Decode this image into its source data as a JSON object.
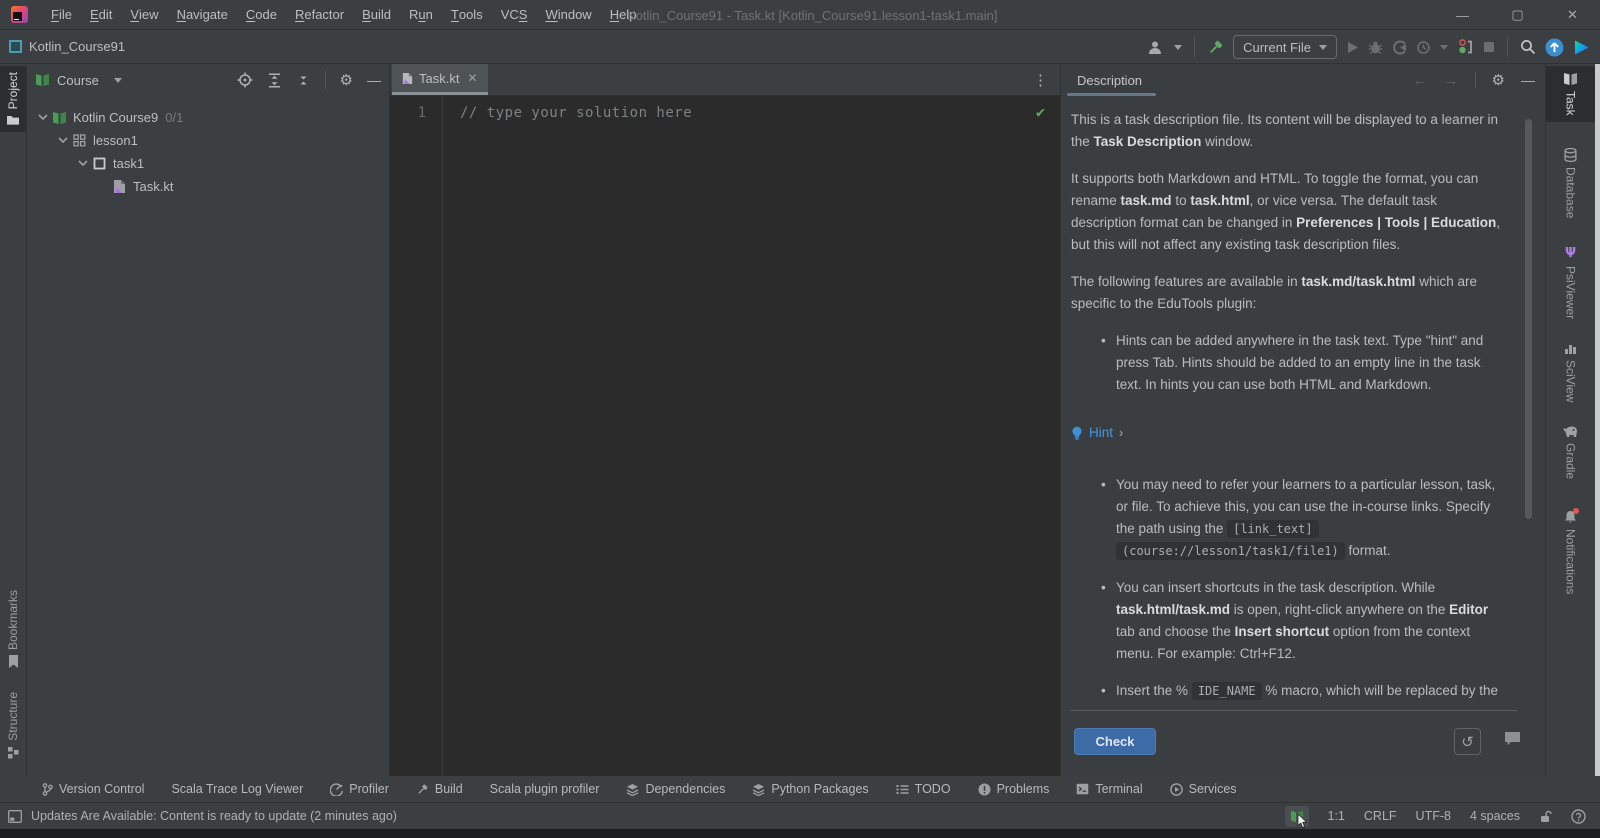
{
  "titlebar": {
    "title": "Kotlin_Course91 - Task.kt [Kotlin_Course91.lesson1-task1.main]",
    "menus": [
      {
        "pre": "",
        "key": "F",
        "post": "ile"
      },
      {
        "pre": "",
        "key": "E",
        "post": "dit"
      },
      {
        "pre": "",
        "key": "V",
        "post": "iew"
      },
      {
        "pre": "",
        "key": "N",
        "post": "avigate"
      },
      {
        "pre": "",
        "key": "C",
        "post": "ode"
      },
      {
        "pre": "",
        "key": "R",
        "post": "efactor"
      },
      {
        "pre": "",
        "key": "B",
        "post": "uild"
      },
      {
        "pre": "R",
        "key": "u",
        "post": "n"
      },
      {
        "pre": "",
        "key": "T",
        "post": "ools"
      },
      {
        "pre": "VC",
        "key": "S",
        "post": ""
      },
      {
        "pre": "",
        "key": "W",
        "post": "indow"
      },
      {
        "pre": "",
        "key": "H",
        "post": "elp"
      }
    ],
    "window_buttons": {
      "minimize": "—",
      "maximize": "▢",
      "close": "✕"
    }
  },
  "toolbar": {
    "project_name": "Kotlin_Course91",
    "run_config": "Current File"
  },
  "left_strip": {
    "items": [
      {
        "label": "Project"
      },
      {
        "label": "Bookmarks"
      },
      {
        "label": "Structure"
      }
    ]
  },
  "right_strip": {
    "items": [
      {
        "label": "Task"
      },
      {
        "label": "Database"
      },
      {
        "label": "PsiViewer"
      },
      {
        "label": "SciView"
      },
      {
        "label": "Gradle"
      },
      {
        "label": "Notifications"
      }
    ]
  },
  "project_panel": {
    "view_selector": "Course",
    "tree": [
      {
        "label": "Kotlin Course9",
        "suffix": "0/1"
      },
      {
        "label": "lesson1",
        "suffix": ""
      },
      {
        "label": "task1",
        "suffix": ""
      },
      {
        "label": "Task.kt",
        "suffix": ""
      }
    ]
  },
  "editor": {
    "tab_label": "Task.kt",
    "close_glyph": "✕",
    "line_number": "1",
    "code": "// type your solution here",
    "inspection_ok": "✔"
  },
  "description": {
    "tab_label": "Description",
    "back_glyph": "←",
    "forward_glyph": "→",
    "blocks": {
      "p1": {
        "s0": "This is a task description file. Its content will be displayed to a learner in the ",
        "s1": "Task Description",
        "s2": " window."
      },
      "p2": {
        "s0": "It supports both Markdown and HTML. To toggle the format, you can rename ",
        "s1": "task.md",
        "s2": " to ",
        "s3": "task.html",
        "s4": ", or vice versa. The default task description format can be changed in ",
        "s5": "Preferences | Tools | Education",
        "s6": ", but this will not affect any existing task description files."
      },
      "p3": {
        "s0": "The following features are available in ",
        "s1": "task.md/task.html",
        "s2": " which are specific to the EduTools plugin:"
      },
      "b1": {
        "s0": "Hints can be added anywhere in the task text. Type \"hint\" and press Tab. Hints should be added to an empty line in the task text. In hints you can use both HTML and Markdown."
      },
      "hint": {
        "label": "Hint",
        "chevron": "›"
      },
      "b2": {
        "s0": "You may need to refer your learners to a particular lesson, task, or file. To achieve this, you can use the in-course links. Specify the path using the ",
        "s1": "[link_text]",
        "s2": " ",
        "s3": "(course://lesson1/task1/file1)",
        "s4": " format."
      },
      "b3": {
        "s0": "You can insert shortcuts in the task description. While ",
        "s1": "task.html/task.md",
        "s2": " is open, right-click anywhere on the ",
        "s3": "Editor",
        "s4": " tab and choose the ",
        "s5": "Insert shortcut",
        "s6": " option from the context menu. For example: Ctrl+F12."
      },
      "b4": {
        "s0": "Insert the %",
        "s1": "IDE_NAME",
        "s2": "% macro, which will be replaced by the"
      }
    },
    "check_label": "Check",
    "reset_glyph": "↺"
  },
  "bottom_bar": {
    "items": [
      {
        "label": "Version Control"
      },
      {
        "label": "Scala Trace Log Viewer"
      },
      {
        "label": "Profiler"
      },
      {
        "label": "Build"
      },
      {
        "label": "Scala plugin profiler"
      },
      {
        "label": "Dependencies"
      },
      {
        "label": "Python Packages"
      },
      {
        "label": "TODO"
      },
      {
        "label": "Problems"
      },
      {
        "label": "Terminal"
      },
      {
        "label": "Services"
      }
    ]
  },
  "status_bar": {
    "message": "Updates Are Available: Content is ready to update (2 minutes ago)",
    "caret": "1:1",
    "line_separator": "CRLF",
    "encoding": "UTF-8",
    "indent": "4 spaces"
  },
  "colors": {
    "accent_blue": "#3d6ba5",
    "link_blue": "#4397e6",
    "course_green": "#499c54",
    "editor_bg": "#2b2b2b",
    "panel_bg": "#3c3f41"
  }
}
